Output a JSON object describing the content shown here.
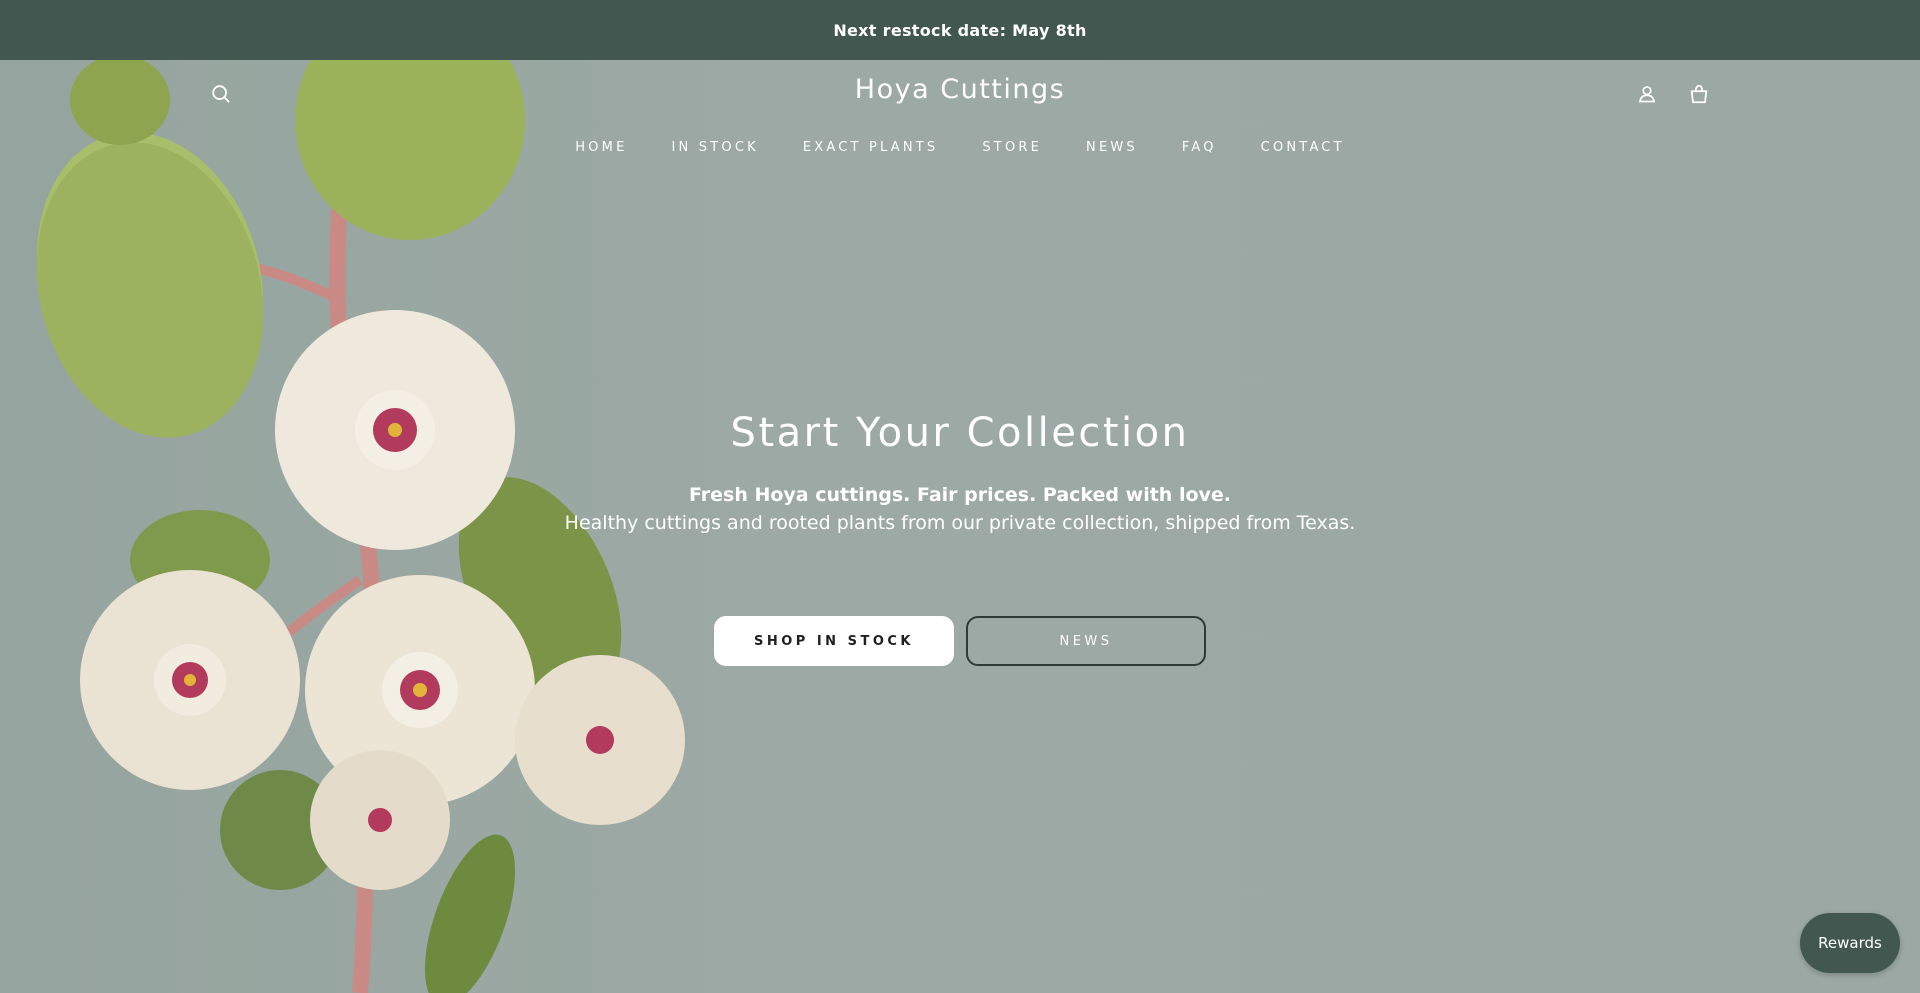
{
  "announcement": {
    "text": "Next restock date: May 8th"
  },
  "header": {
    "logo": "Hoya Cuttings",
    "icons": {
      "search": "search-icon",
      "account": "user-icon",
      "cart": "bag-icon"
    }
  },
  "nav": {
    "items": [
      {
        "label": "HOME"
      },
      {
        "label": "IN STOCK"
      },
      {
        "label": "EXACT PLANTS"
      },
      {
        "label": "STORE"
      },
      {
        "label": "NEWS"
      },
      {
        "label": "FAQ"
      },
      {
        "label": "CONTACT"
      }
    ]
  },
  "hero": {
    "title": "Start Your Collection",
    "tagline": "Fresh Hoya cuttings. Fair prices. Packed with love.",
    "subline": "Healthy cuttings and rooted plants from our private collection, shipped from Texas.",
    "primary_button": "SHOP IN STOCK",
    "secondary_button": "NEWS"
  },
  "rewards": {
    "label": "Rewards"
  },
  "colors": {
    "announcement_bg": "#41574f",
    "hero_bg": "#9ba8a3",
    "button_primary_bg": "#ffffff",
    "button_secondary_border": "#2f3a36"
  }
}
